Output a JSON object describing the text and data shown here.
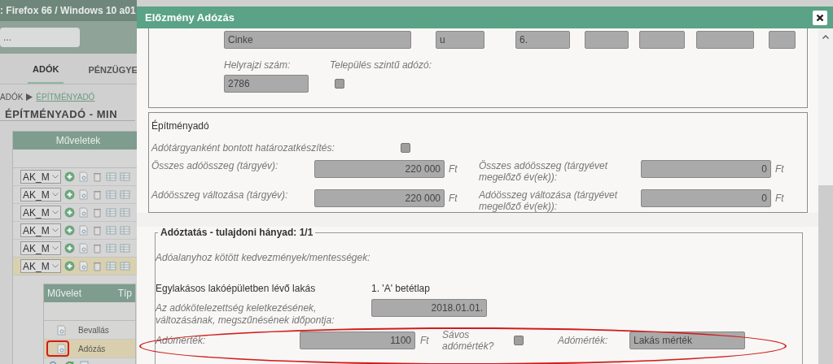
{
  "top_bar": {
    "title": ": Firefox 66 / Windows 10 a01"
  },
  "search": {
    "value": "..."
  },
  "nav_tabs": [
    {
      "label": "ADÓK",
      "selected": true
    },
    {
      "label": "PÉNZÜGYE",
      "selected": false
    }
  ],
  "breadcrumb": [
    {
      "label": "ADÓK",
      "link": false
    },
    {
      "label": "ÉPÍTMÉNYADÓ",
      "link": true
    }
  ],
  "page_title": "ÉPÍTMÉNYADÓ - MIN",
  "operations": {
    "header": "Műveletek",
    "rows": [
      {
        "select": "AK_M",
        "selected": false
      },
      {
        "select": "AK_M",
        "selected": false
      },
      {
        "select": "AK_M",
        "selected": false
      },
      {
        "select": "AK_M",
        "selected": false
      },
      {
        "select": "AK_M",
        "selected": false
      },
      {
        "select": "AK_M",
        "selected": true
      }
    ]
  },
  "history_table": {
    "columns": [
      "Művelet",
      "Típ"
    ],
    "rows": [
      {
        "type": "Bevallás",
        "selected": false
      },
      {
        "type": "Adózás",
        "selected": true
      }
    ]
  },
  "dialog": {
    "title": "Előzmény Adózás",
    "address_fields": [
      {
        "kind": "text",
        "value": "Cinke"
      },
      {
        "kind": "text",
        "value": "u"
      },
      {
        "kind": "text",
        "value": "6."
      },
      {
        "kind": "empty"
      },
      {
        "kind": "empty"
      },
      {
        "kind": "empty"
      },
      {
        "kind": "empty"
      }
    ],
    "parcel_number": {
      "label": "Helyrajzi szám:",
      "value": "2786"
    },
    "municipal_taxpayer": {
      "label": "Település szintű adózó:",
      "checked": false
    },
    "tax_section": {
      "title": "Építményadó",
      "split_decision": {
        "label": "Adótárgyanként bontott határozatkészítés:",
        "checked": false
      },
      "amounts": [
        {
          "label": "Összes adóösszeg (tárgyév):",
          "value": "220 000",
          "unit": "Ft"
        },
        {
          "label": "Összes adóösszeg (tárgyévet megelőző év(ek)):",
          "value": "0",
          "unit": "Ft"
        },
        {
          "label": "Adóösszeg változása (tárgyév):",
          "value": "220 000",
          "unit": "Ft"
        },
        {
          "label": "Adóösszeg változása (tárgyévet megelőző év(ek)):",
          "value": "0",
          "unit": "Ft"
        }
      ]
    },
    "taxation": {
      "legend": "Adóztatás - tulajdoni hányad: 1/1",
      "benefits_label": "Adóalanyhoz kötött kedvezmények/mentességek:",
      "property_type": "Egylakásos lakóépületben lévő lakás",
      "sheet": "1. 'A' betétlap",
      "date": {
        "label": "Az adókötelezettség keletkezésének, változásának, megszűnésének időpontja:",
        "value": "2018.01.01."
      },
      "rate": {
        "label": "Adómérték:",
        "value": "1100",
        "unit": "Ft"
      },
      "banded": {
        "label": "Sávos adómérték?",
        "checked": false
      },
      "rate_type": {
        "label": "Adómérték:",
        "value": "Lakás mérték"
      }
    }
  }
}
